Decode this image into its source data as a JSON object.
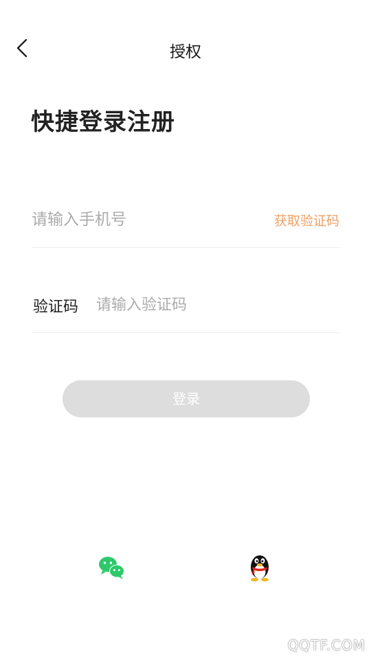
{
  "header": {
    "back_icon": "chevron-left-icon",
    "title": "授权"
  },
  "page": {
    "title": "快捷登录注册"
  },
  "phone": {
    "value": "",
    "placeholder": "请输入手机号",
    "get_code_label": "获取验证码"
  },
  "code": {
    "label": "验证码",
    "value": "",
    "placeholder": "请输入验证码"
  },
  "login": {
    "label": "登录"
  },
  "social": {
    "wechat_icon": "wechat-icon",
    "qq_icon": "qq-icon"
  },
  "watermark": {
    "text": "QQTF.COM"
  },
  "colors": {
    "accent": "#f0a064",
    "button_disabled": "#dddddd",
    "divider": "#ececec",
    "placeholder": "#ababab",
    "wechat_green": "#2dc96a"
  }
}
